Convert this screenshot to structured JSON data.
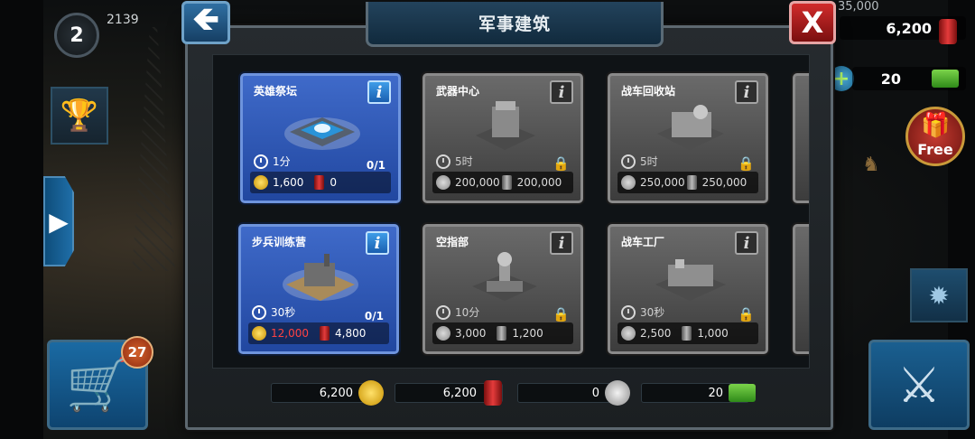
{
  "hud": {
    "level": "2",
    "xp": "2139",
    "gold_capacity": "35,000",
    "oil_top": "6,200",
    "cash_top": "20",
    "free_label": "Free",
    "shop_badge": "27"
  },
  "dialog": {
    "title": "军事建筑",
    "back_label": "🡸",
    "close_label": "X"
  },
  "cards": [
    {
      "name": "英雄祭坛",
      "time": "1分",
      "count": "0/1",
      "gold": "1,600",
      "oil": "0",
      "state": "active"
    },
    {
      "name": "武器中心",
      "time": "5时",
      "silver": "200,000",
      "oil": "200,000",
      "state": "locked"
    },
    {
      "name": "战车回收站",
      "time": "5时",
      "silver": "250,000",
      "oil": "250,000",
      "state": "locked"
    },
    {
      "name": "步兵训练营",
      "time": "30秒",
      "count": "0/1",
      "gold": "12,000",
      "oil": "4,800",
      "state": "active"
    },
    {
      "name": "空指部",
      "time": "10分",
      "silver": "3,000",
      "oil": "1,200",
      "state": "locked"
    },
    {
      "name": "战车工厂",
      "time": "30秒",
      "silver": "2,500",
      "oil": "1,000",
      "state": "locked"
    }
  ],
  "resources": {
    "gold": "6,200",
    "oil": "6,200",
    "silver": "0",
    "cash": "20"
  },
  "colors": {
    "active_card": "#2f5bbd",
    "locked_card": "#555555",
    "insufficient": "#ff4242"
  }
}
